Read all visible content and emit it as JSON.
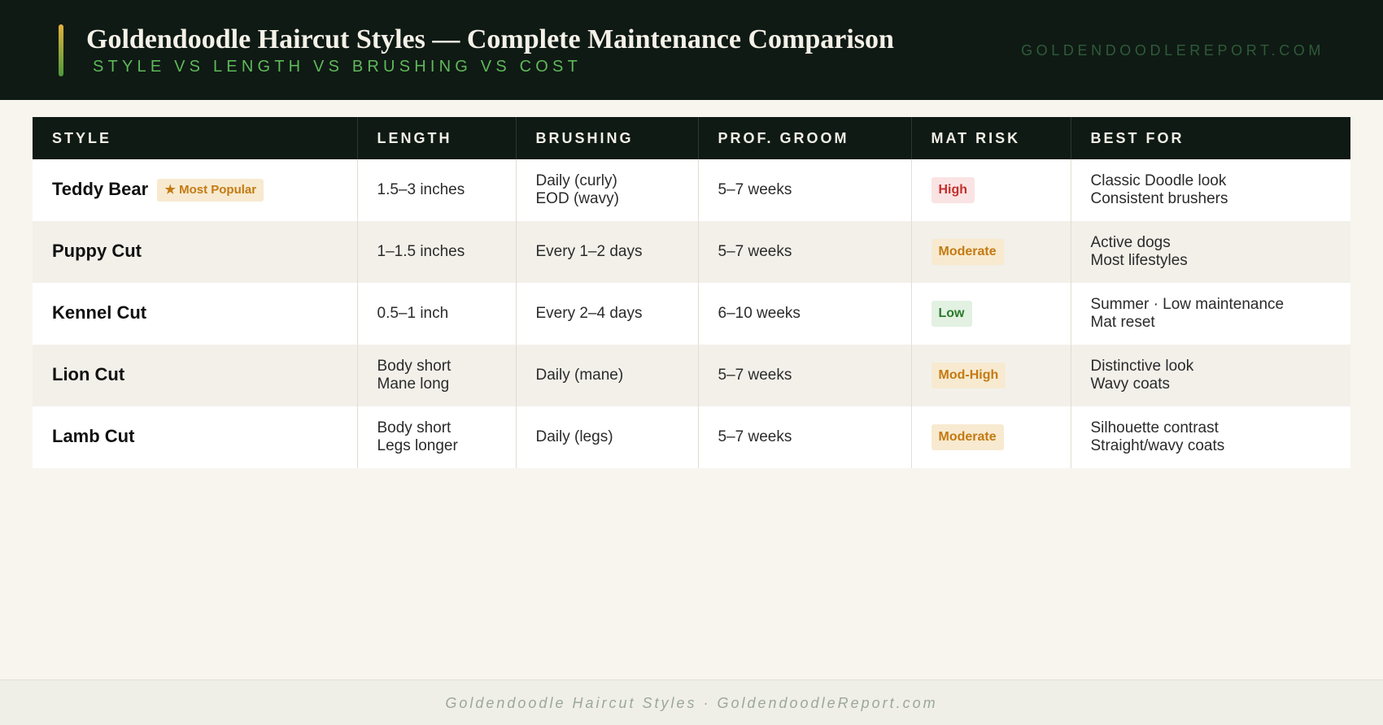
{
  "header": {
    "title": "Goldendoodle Haircut Styles — Complete Maintenance Comparison",
    "subtitle": "STYLE VS LENGTH VS BRUSHING VS COST",
    "site": "GOLDENDOODLEREPORT.COM"
  },
  "table": {
    "columns": [
      "STYLE",
      "LENGTH",
      "BRUSHING",
      "PROF. GROOM",
      "MAT RISK",
      "BEST FOR"
    ],
    "rows": [
      {
        "style": "Teddy Bear",
        "tag": "★ Most Popular",
        "length": [
          "1.5–3 inches"
        ],
        "brushing": [
          "Daily (curly)",
          "EOD (wavy)"
        ],
        "groom": "5–7 weeks",
        "risk": "High",
        "best_for": [
          "Classic Doodle look",
          "Consistent brushers"
        ]
      },
      {
        "style": "Puppy Cut",
        "length": [
          "1–1.5 inches"
        ],
        "brushing": [
          "Every 1–2 days"
        ],
        "groom": "5–7 weeks",
        "risk": "Moderate",
        "best_for": [
          "Active dogs",
          "Most lifestyles"
        ]
      },
      {
        "style": "Kennel Cut",
        "length": [
          "0.5–1 inch"
        ],
        "brushing": [
          "Every 2–4 days"
        ],
        "groom": "6–10 weeks",
        "risk": "Low",
        "best_for": [
          "Summer · Low maintenance",
          "Mat reset"
        ]
      },
      {
        "style": "Lion Cut",
        "length": [
          "Body short",
          "Mane long"
        ],
        "brushing": [
          "Daily (mane)"
        ],
        "groom": "5–7 weeks",
        "risk": "Mod-High",
        "best_for": [
          "Distinctive look",
          "Wavy coats"
        ]
      },
      {
        "style": "Lamb Cut",
        "length": [
          "Body short",
          "Legs longer"
        ],
        "brushing": [
          "Daily (legs)"
        ],
        "groom": "5–7 weeks",
        "risk": "Moderate",
        "best_for": [
          "Silhouette contrast",
          "Straight/wavy coats"
        ]
      }
    ]
  },
  "risk_colors": {
    "High": "#c4302b",
    "Moderate": "#c47a12",
    "Low": "#2b7a2b",
    "Mod-High": "#c47a12"
  },
  "footer": {
    "text": "Goldendoodle Haircut Styles · GoldendoodleReport.com"
  }
}
